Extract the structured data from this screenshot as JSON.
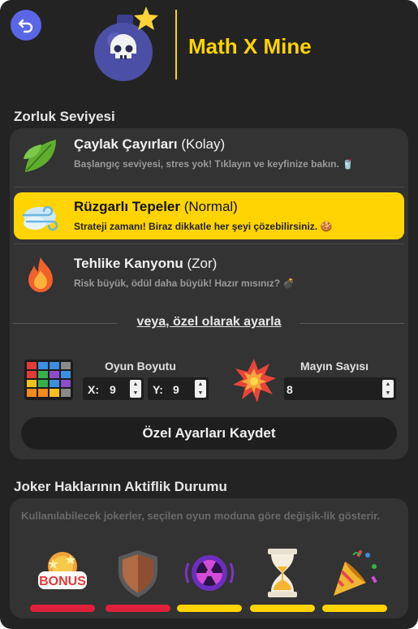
{
  "app": {
    "title": "Math X Mine"
  },
  "icons": {
    "back": "back-arrow-icon",
    "logo": "bomb-skull-icon"
  },
  "difficulty": {
    "section_title": "Zorluk Seviyesi",
    "levels": [
      {
        "name": "Çaylak Çayırları",
        "tag": "(Kolay)",
        "desc": "Başlangıç seviyesi, stres yok! Tıklayın ve keyfinize bakın.",
        "icon": "leaf-icon",
        "emoji": "🥤",
        "active": false
      },
      {
        "name": "Rüzgarlı Tepeler",
        "tag": "(Normal)",
        "desc": "Strateji zamanı! Biraz dikkatle her şeyi çözebilirsiniz.",
        "icon": "wind-icon",
        "emoji": "🍪",
        "active": true
      },
      {
        "name": "Tehlike Kanyonu",
        "tag": "(Zor)",
        "desc": "Risk büyük, ödül daha büyük! Hazır mısınız?",
        "icon": "fire-icon",
        "emoji": "💣",
        "active": false
      }
    ],
    "or_text": "veya, özel olarak ayarla"
  },
  "custom": {
    "board_label": "Oyun Boyutu",
    "x_label": "X:",
    "x_value": "9",
    "y_label": "Y:",
    "y_value": "9",
    "mines_label": "Mayın Sayısı",
    "mines_value": "8",
    "save_label": "Özel Ayarları Kaydet"
  },
  "jokers": {
    "section_title": "Joker Haklarının Aktiflik Durumu",
    "note": "Kullanılabilecek jokerler, seçilen oyun moduna göre değişik-lik gösterir.",
    "items": [
      {
        "icon": "bonus-icon",
        "badge": "BONUS",
        "status": "inactive",
        "color": "#e0203a"
      },
      {
        "icon": "shield-icon",
        "status": "inactive",
        "color": "#e0203a"
      },
      {
        "icon": "radiation-icon",
        "status": "active",
        "color": "#ffd400"
      },
      {
        "icon": "hourglass-icon",
        "status": "active",
        "color": "#ffd400"
      },
      {
        "icon": "party-popper-icon",
        "status": "active",
        "color": "#ffd400"
      }
    ]
  }
}
